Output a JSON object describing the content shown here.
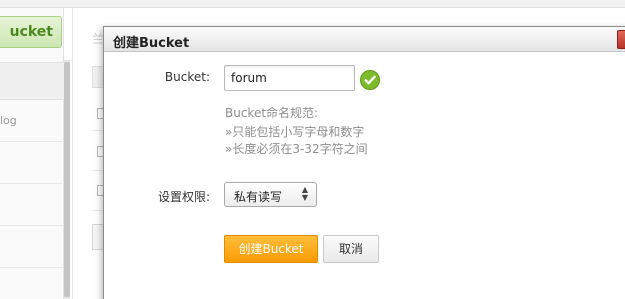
{
  "background": {
    "faint_top_text": "...",
    "bucket_button_label": "ucket",
    "left_rows": [
      "log",
      "",
      "",
      ""
    ],
    "mid_text": "兰"
  },
  "dialog": {
    "title": "创建Bucket",
    "bucket_label": "Bucket:",
    "bucket_name_value": "forum",
    "hint_title": "Bucket命名规范:",
    "hint_rules": [
      "»只能包括小写字母和数字",
      "»长度必须在3-32字符之间"
    ],
    "permission_label": "设置权限:",
    "permission_selected": "私有读写",
    "create_button_label": "创建Bucket",
    "cancel_button_label": "取消"
  },
  "colors": {
    "primary_button": "#f89b05",
    "valid_icon": "#7cbb2a",
    "close_button": "#c0392b",
    "hint_text": "#8e8e8e"
  },
  "icons": {
    "valid": "check-circle-icon",
    "close": "close-icon",
    "select_arrows": "up-down-arrows-icon"
  }
}
